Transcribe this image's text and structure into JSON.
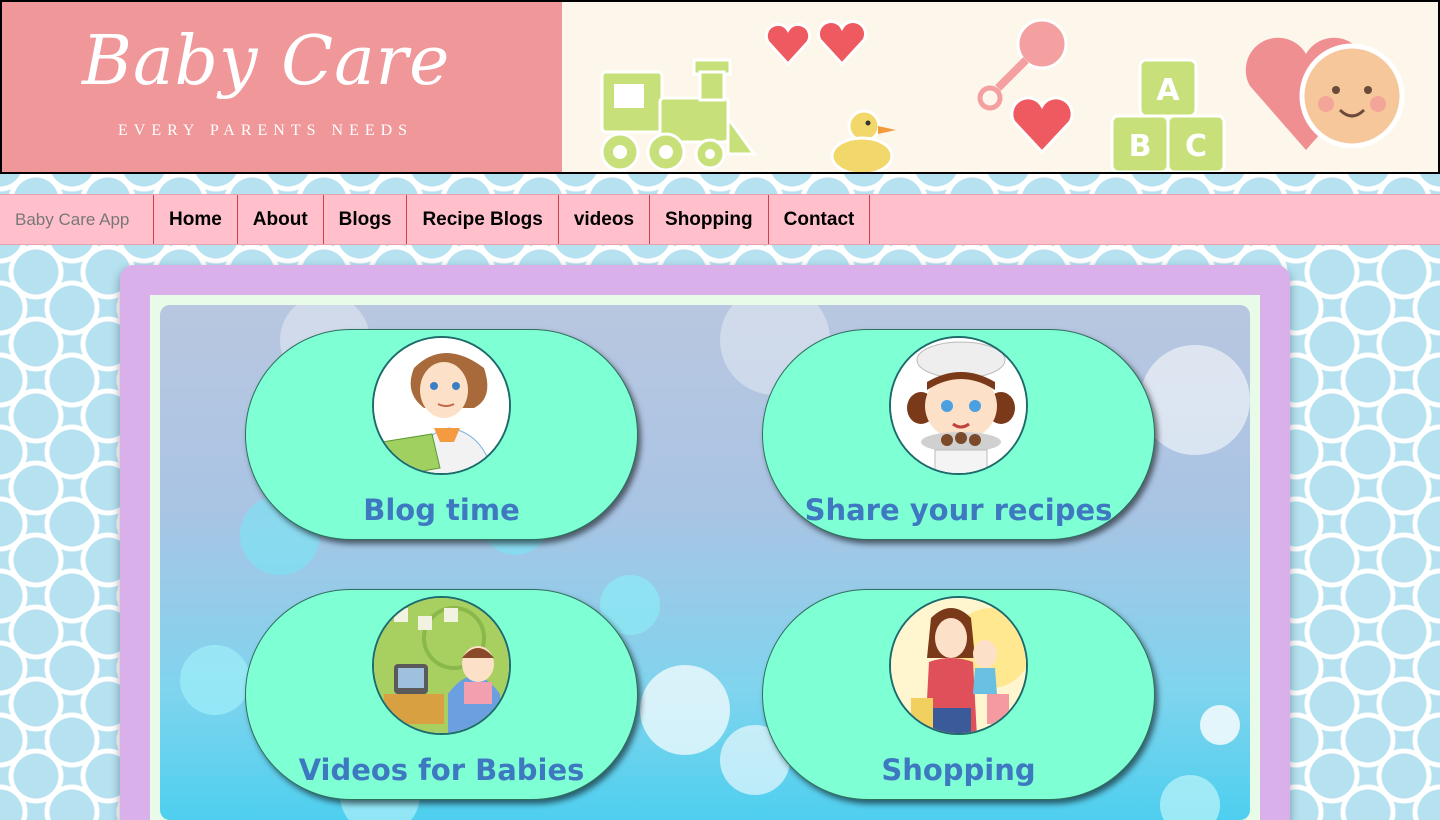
{
  "banner": {
    "title": "Baby Care",
    "subtitle": "EVERY PARENTS NEEDS"
  },
  "navbar": {
    "brand": "Baby Care App",
    "items": [
      {
        "label": "Home"
      },
      {
        "label": "About"
      },
      {
        "label": "Blogs"
      },
      {
        "label": "Recipe Blogs"
      },
      {
        "label": "videos"
      },
      {
        "label": "Shopping"
      },
      {
        "label": "Contact"
      }
    ]
  },
  "cards": [
    {
      "label": "Blog time",
      "icon": "mother-laptop-icon"
    },
    {
      "label": "Share your recipes",
      "icon": "girl-chef-icon"
    },
    {
      "label": "Videos for Babies",
      "icon": "kids-tv-icon"
    },
    {
      "label": "Shopping",
      "icon": "mother-shopping-icon"
    }
  ],
  "colors": {
    "banner_pink": "#f0979a",
    "banner_cream": "#fdf6ea",
    "navbar_bg": "#ffc0cb",
    "nav_divider": "#d0404a",
    "panel_purple": "#d9b0ea",
    "card_bg": "#7fffd4",
    "card_text": "#3d78c0",
    "page_bg": "#b5e1f1"
  }
}
